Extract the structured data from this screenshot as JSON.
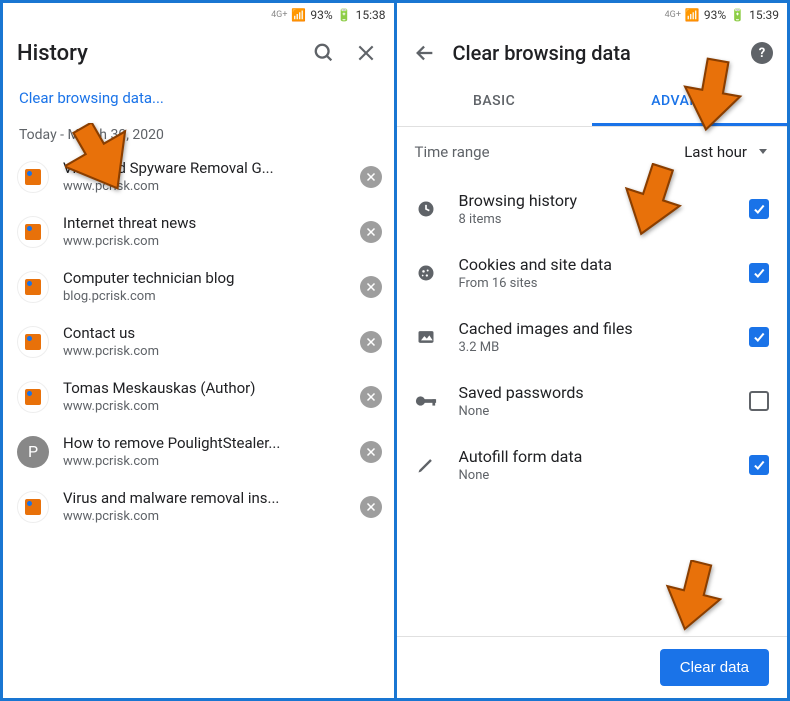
{
  "status": {
    "net": "4G+",
    "battery_pct": "93%",
    "time_left": "15:38",
    "time_right": "15:39"
  },
  "left": {
    "title": "History",
    "clear_link": "Clear browsing data...",
    "date_header": "Today - March 30, 2020",
    "items": [
      {
        "title": "Virus and Spyware Removal G...",
        "url": "www.pcrisk.com",
        "icon": "pc"
      },
      {
        "title": "Internet threat news",
        "url": "www.pcrisk.com",
        "icon": "pc"
      },
      {
        "title": "Computer technician blog",
        "url": "blog.pcrisk.com",
        "icon": "pc"
      },
      {
        "title": "Contact us",
        "url": "www.pcrisk.com",
        "icon": "pc"
      },
      {
        "title": "Tomas Meskauskas (Author)",
        "url": "www.pcrisk.com",
        "icon": "pc"
      },
      {
        "title": "How to remove PoulightStealer...",
        "url": "www.pcrisk.com",
        "icon": "p"
      },
      {
        "title": "Virus and malware removal ins...",
        "url": "www.pcrisk.com",
        "icon": "pc"
      }
    ]
  },
  "right": {
    "title": "Clear browsing data",
    "tabs": {
      "basic": "BASIC",
      "advanced": "ADVANCED"
    },
    "timerange": {
      "label": "Time range",
      "value": "Last hour"
    },
    "items": [
      {
        "icon": "clock",
        "title": "Browsing history",
        "sub": "8 items",
        "checked": true
      },
      {
        "icon": "cookie",
        "title": "Cookies and site data",
        "sub": "From 16 sites",
        "checked": true
      },
      {
        "icon": "image",
        "title": "Cached images and files",
        "sub": "3.2 MB",
        "checked": true
      },
      {
        "icon": "key",
        "title": "Saved passwords",
        "sub": "None",
        "checked": false
      },
      {
        "icon": "pencil",
        "title": "Autofill form data",
        "sub": "None",
        "checked": true
      }
    ],
    "clear_btn": "Clear data"
  }
}
